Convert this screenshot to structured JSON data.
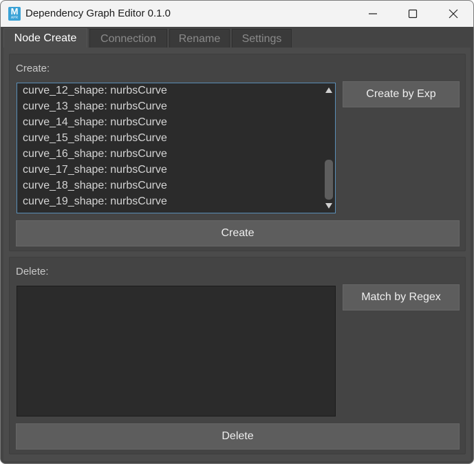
{
  "window": {
    "title": "Dependency Graph Editor 0.1.0",
    "app_icon": {
      "letter": "M",
      "sub": "APR"
    }
  },
  "tabs": [
    {
      "label": "Node Create",
      "active": true
    },
    {
      "label": "Connection",
      "active": false
    },
    {
      "label": "Rename",
      "active": false
    },
    {
      "label": "Settings",
      "active": false
    }
  ],
  "create": {
    "label": "Create:",
    "items": [
      "curve_12_shape: nurbsCurve",
      "curve_13_shape: nurbsCurve",
      "curve_14_shape: nurbsCurve",
      "curve_15_shape: nurbsCurve",
      "curve_16_shape: nurbsCurve",
      "curve_17_shape: nurbsCurve",
      "curve_18_shape: nurbsCurve",
      "curve_19_shape: nurbsCurve"
    ],
    "side_button": "Create by Exp",
    "action_button": "Create"
  },
  "delete": {
    "label": "Delete:",
    "items": [],
    "side_button": "Match by Regex",
    "action_button": "Delete"
  },
  "colors": {
    "accent_focus": "#5a8fb8",
    "app_icon": "#3aa2d6"
  }
}
